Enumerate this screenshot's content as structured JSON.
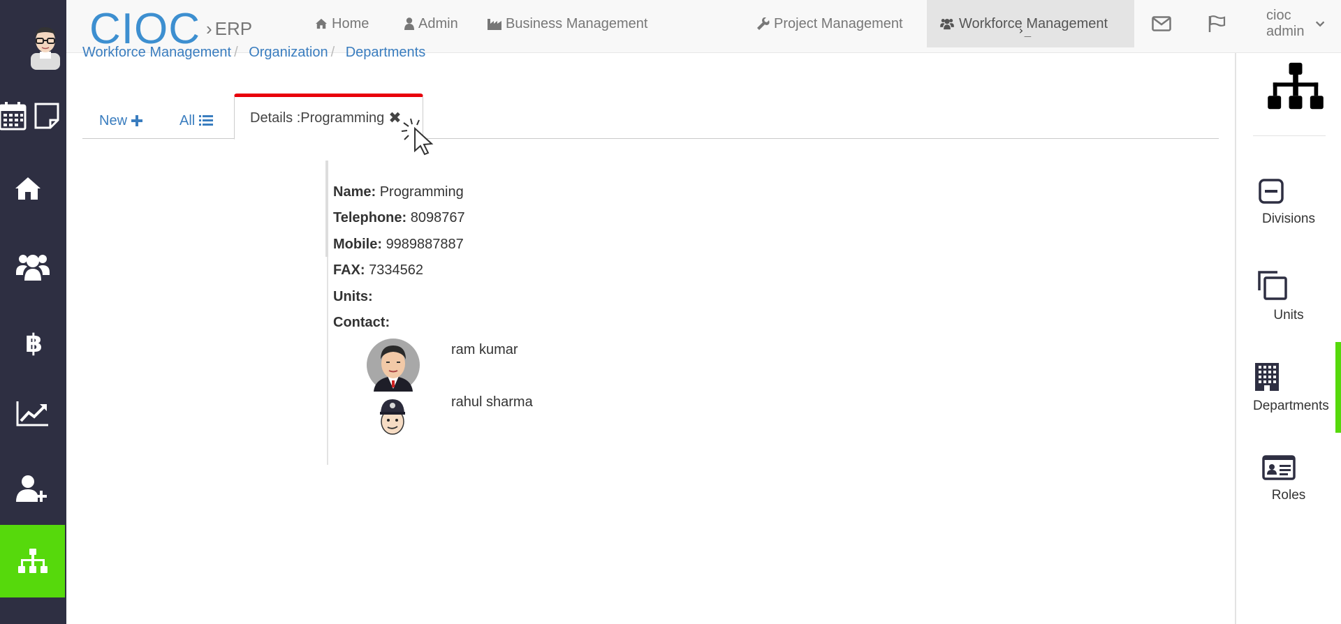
{
  "brand": {
    "logo": "CIOC",
    "separator": "›",
    "subtitle": "ERP"
  },
  "nav": {
    "home": "Home",
    "admin": "Admin",
    "business": "Business Management",
    "project": "Project Management",
    "workforce": "Workforce Management",
    "user": "cioc admin",
    "terminal_glyph": "›_"
  },
  "breadcrumb": [
    "Workforce Management",
    "Organization",
    "Departments"
  ],
  "tabs": {
    "new": "New",
    "all": "All",
    "details": "Details :Programming",
    "close": "✖"
  },
  "details": {
    "name_label": "Name:",
    "name_value": "Programming",
    "telephone_label": "Telephone:",
    "telephone_value": "8098767",
    "mobile_label": "Mobile:",
    "mobile_value": "9989887887",
    "fax_label": "FAX:",
    "fax_value": "7334562",
    "units_label": "Units:",
    "contact_label": "Contact:",
    "contacts": [
      {
        "name": "ram kumar"
      },
      {
        "name": "rahul sharma"
      }
    ]
  },
  "right_panel": {
    "divisions": "Divisions",
    "units": "Units",
    "departments": "Departments",
    "roles": "Roles"
  },
  "colors": {
    "sidebar": "#2e2f42",
    "accent_green": "#56d90c",
    "brand_blue": "#3d8fd0",
    "tab_red": "#e8000b"
  },
  "icons": {
    "sidebar": [
      "calendar-icon",
      "note-icon",
      "home-icon",
      "users-icon",
      "bitcoin-icon",
      "chart-icon",
      "user-plus-icon",
      "sitemap-icon"
    ]
  }
}
